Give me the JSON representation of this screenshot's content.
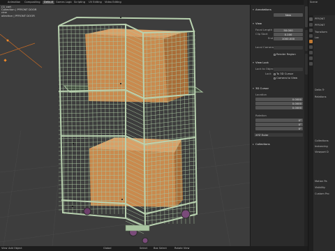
{
  "tabs": [
    "Animation",
    "Compositing",
    "Default",
    "Games Logic",
    "Scripting",
    "UV Editing",
    "Video Editing"
  ],
  "active_tab_index": 2,
  "top_right": {
    "scene_label": "Scene"
  },
  "viewport": {
    "info_line1": "(1) cart",
    "info_line2": "Collection | PFRONT DOOR",
    "left_labels": [
      "cine",
      "ollection | PFRONT DOOR"
    ]
  },
  "npanel": {
    "annotations_header": "Annotations",
    "annotations_new": "New",
    "view_header": "View",
    "focal_length_label": "Focal Length",
    "focal_length_value": "50.000",
    "clip_start_label": "Clip Start",
    "clip_start_value": "0.100",
    "clip_end_label": "End",
    "clip_end_value": "1000.000",
    "local_camera_label": "Local Camera",
    "render_region_label": "Render Region",
    "view_lock_header": "View Lock",
    "lock_to_object_label": "Lock to Object",
    "lock_label": "Lock",
    "to_3d_cursor_label": "To 3D Cursor",
    "camera_to_view_label": "Camera to View",
    "cursor_header": "3D Cursor",
    "location_label": "Location",
    "loc_x_label": "X",
    "loc_x_value": "0.0000",
    "loc_y_label": "Y",
    "loc_y_value": "0.0000",
    "loc_z_label": "Z",
    "loc_z_value": "0.0000",
    "rotation_label": "Rotation",
    "rot_x_label": "X",
    "rot_x_value": "0°",
    "rot_y_label": "Y",
    "rot_y_value": "0°",
    "rot_z_label": "Z",
    "rot_z_value": "0°",
    "rotation_mode": "XYZ Euler",
    "collections_header": "Collections"
  },
  "props": {
    "items": [
      "PFRONT",
      "PFRONT",
      "Transform",
      "Loc",
      "Delta Tr",
      "Relations",
      "Collections",
      "Instancing",
      "Viewport D",
      "Motion Pa",
      "Visibility",
      "Custom Pro"
    ]
  },
  "statusbar": {
    "select_label": "Select",
    "box_select_label": "Box Select",
    "rotate_view_label": "Rotate View",
    "menu_items": [
      "View",
      "Add",
      "Object"
    ],
    "global_label": "Global"
  },
  "colors": {
    "viewport_bg": "#3d3d3d",
    "cage_color": "#a9c4a0",
    "box_color": "#c98a4e",
    "active_tab": "#474747",
    "wheel_color": "#7a4b7a"
  }
}
